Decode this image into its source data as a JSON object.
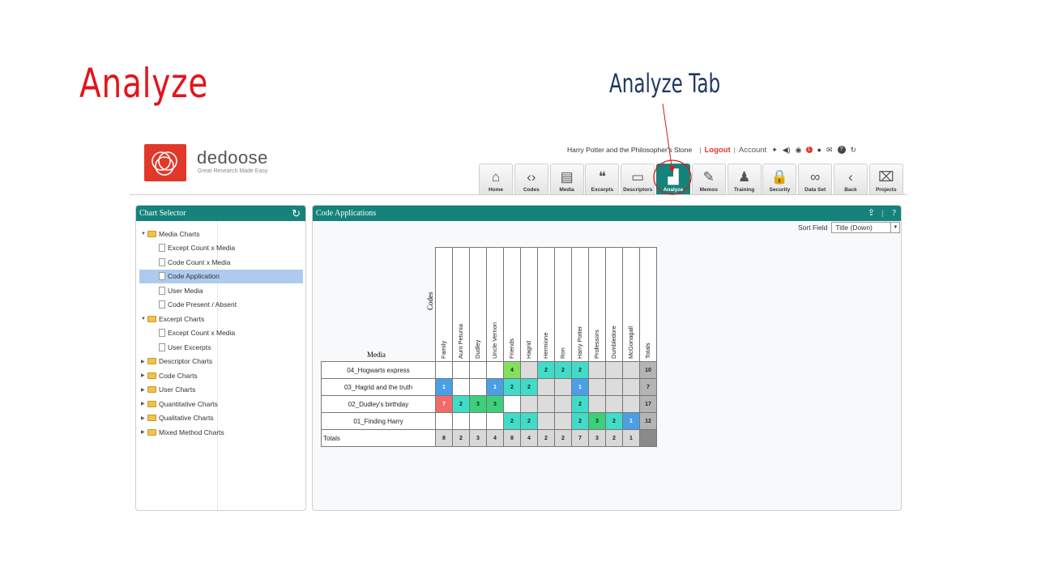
{
  "slide": {
    "title": "Analyze",
    "callout": "Analyze Tab"
  },
  "app": {
    "logo_name": "dedoose",
    "logo_tagline": "Great Research Made Easy",
    "project": "Harry Potter and the Philosopher's Stone",
    "logout": "Logout",
    "account": "Account",
    "badge_count": "1"
  },
  "nav": [
    {
      "label": "Home",
      "icon": "home-icon",
      "glyph": "⌂",
      "active": false
    },
    {
      "label": "Codes",
      "icon": "code-brackets-icon",
      "glyph": "‹›",
      "active": false
    },
    {
      "label": "Media",
      "icon": "newspaper-icon",
      "glyph": "▤",
      "active": false
    },
    {
      "label": "Excerpts",
      "icon": "quote-icon",
      "glyph": "❝",
      "active": false
    },
    {
      "label": "Descriptors",
      "icon": "clipboard-icon",
      "glyph": "▭",
      "active": false
    },
    {
      "label": "Analyze",
      "icon": "bar-chart-icon",
      "glyph": "▟",
      "active": true
    },
    {
      "label": "Memos",
      "icon": "memo-icon",
      "glyph": "✎",
      "active": false
    },
    {
      "label": "Training",
      "icon": "person-icon",
      "glyph": "♟",
      "active": false
    },
    {
      "label": "Security",
      "icon": "lock-icon",
      "glyph": "🔒",
      "active": false
    },
    {
      "label": "Data Set",
      "icon": "binoculars-icon",
      "glyph": "∞",
      "active": false
    },
    {
      "label": "Back",
      "icon": "chevron-left-icon",
      "glyph": "‹",
      "active": false
    },
    {
      "label": "Projects",
      "icon": "projects-icon",
      "glyph": "⌧",
      "active": false
    }
  ],
  "chart_selector": {
    "title": "Chart Selector",
    "items": [
      {
        "label": "Media Charts",
        "kind": "folder",
        "expanded": true,
        "level": 0,
        "selected": false
      },
      {
        "label": "Except Count x Media",
        "kind": "doc",
        "level": 1,
        "selected": false
      },
      {
        "label": "Code Count x Media",
        "kind": "doc",
        "level": 1,
        "selected": false
      },
      {
        "label": "Code Application",
        "kind": "doc",
        "level": 1,
        "selected": true
      },
      {
        "label": "User Media",
        "kind": "doc",
        "level": 1,
        "selected": false
      },
      {
        "label": "Code Present / Absent",
        "kind": "doc",
        "level": 1,
        "selected": false
      },
      {
        "label": "Excerpt Charts",
        "kind": "folder",
        "expanded": true,
        "level": 0,
        "selected": false
      },
      {
        "label": "Except Count x Media",
        "kind": "doc",
        "level": 1,
        "selected": false
      },
      {
        "label": "User Excerpts",
        "kind": "doc",
        "level": 1,
        "selected": false
      },
      {
        "label": "Descriptor Charts",
        "kind": "folder",
        "expanded": false,
        "level": 0,
        "selected": false
      },
      {
        "label": "Code Charts",
        "kind": "folder",
        "expanded": false,
        "level": 0,
        "selected": false
      },
      {
        "label": "User Charts",
        "kind": "folder",
        "expanded": false,
        "level": 0,
        "selected": false
      },
      {
        "label": "Quantitative Charts",
        "kind": "folder",
        "expanded": false,
        "level": 0,
        "selected": false
      },
      {
        "label": "Qualitative Charts",
        "kind": "folder",
        "expanded": false,
        "level": 0,
        "selected": false
      },
      {
        "label": "Mixed Method Charts",
        "kind": "folder",
        "expanded": false,
        "level": 0,
        "selected": false
      }
    ]
  },
  "code_applications": {
    "title": "Code Applications",
    "sort_label": "Sort Field",
    "sort_value": "Title (Down)"
  },
  "chart_data": {
    "type": "heatmap",
    "corner_codes": "Codes",
    "corner_media": "Media",
    "columns": [
      "Family",
      "Aunt Petunia",
      "Dudley",
      "Uncle Vernon",
      "Friends",
      "Hagrid",
      "Hermione",
      "Ron",
      "Harry Potter",
      "Professors",
      "Dumbledore",
      "McGonagall",
      "Totals"
    ],
    "rows": [
      {
        "label": "04_Hogwarts express",
        "values": [
          null,
          null,
          null,
          null,
          4,
          null,
          2,
          2,
          2,
          null,
          null,
          null
        ],
        "total": 10
      },
      {
        "label": "03_Hagrid and the truth",
        "values": [
          1,
          null,
          null,
          1,
          2,
          2,
          null,
          null,
          1,
          null,
          null,
          null
        ],
        "total": 7
      },
      {
        "label": "02_Dudley's birthday",
        "values": [
          7,
          2,
          3,
          3,
          null,
          null,
          null,
          null,
          2,
          null,
          null,
          null
        ],
        "total": 17
      },
      {
        "label": "01_Finding Harry",
        "values": [
          null,
          null,
          null,
          null,
          2,
          2,
          null,
          null,
          2,
          3,
          2,
          1
        ],
        "total": 12
      }
    ],
    "totals_label": "Totals",
    "column_totals": [
      8,
      2,
      3,
      4,
      8,
      4,
      2,
      2,
      7,
      3,
      2,
      1
    ],
    "colors": {
      "1": "#4a9fe6",
      "2": "#40dcc8",
      "3": "#3cd07a",
      "4": "#84e05a",
      "7": "#f26a6a",
      "empty_light": "#ffffff",
      "empty_gray": "#dcdcdc",
      "totals": "#b4b4b4"
    }
  }
}
